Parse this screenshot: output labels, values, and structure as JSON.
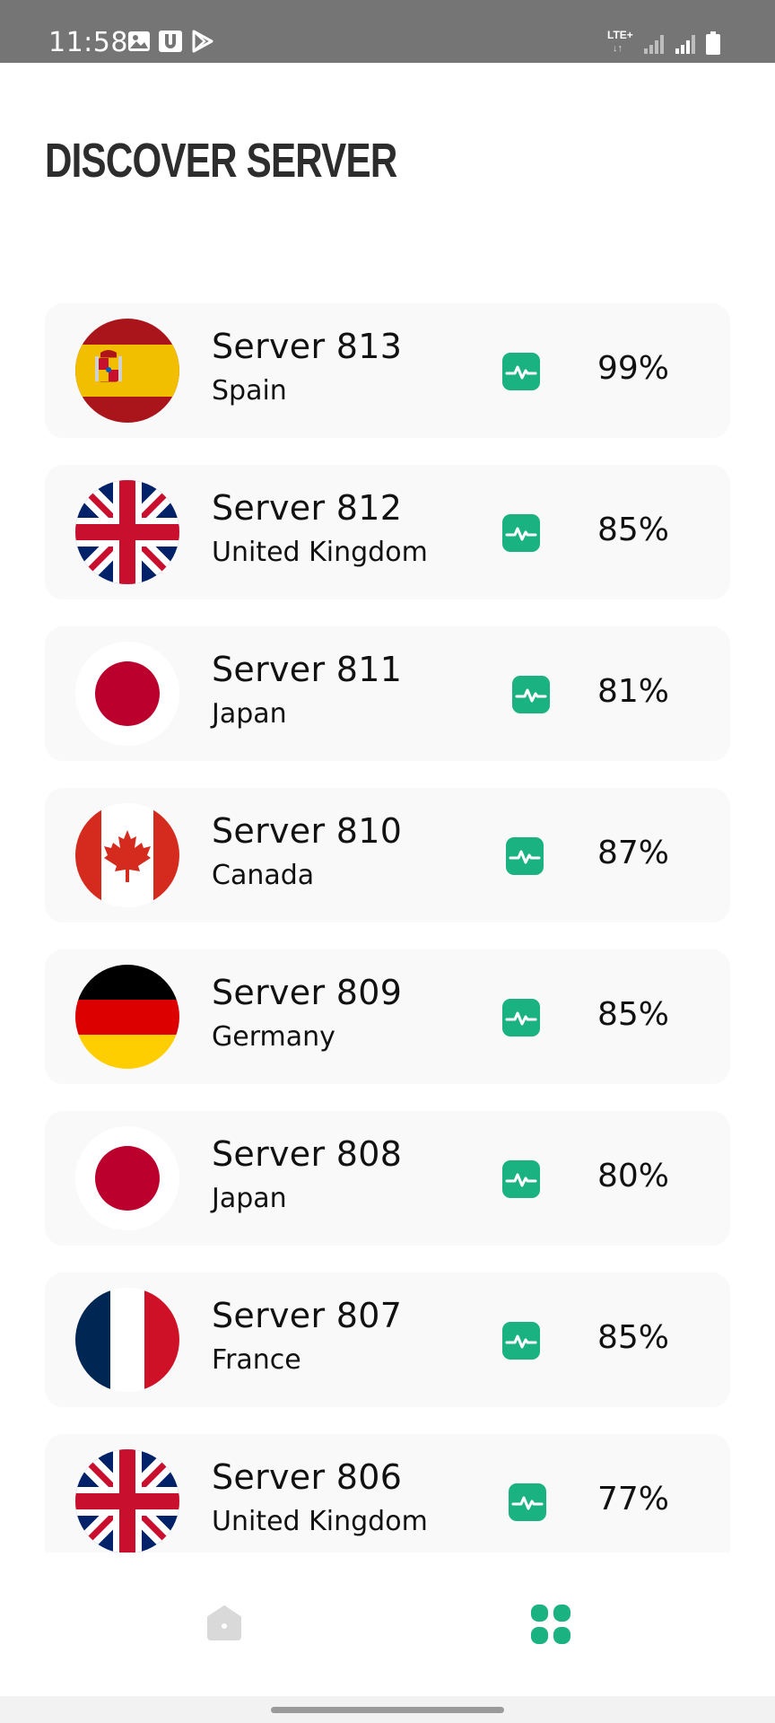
{
  "status_bar": {
    "time": "11:58",
    "network": "LTE+",
    "icons": [
      "image-icon",
      "u-app-icon",
      "play-store-icon",
      "lte-icon",
      "signal-icon",
      "signal-icon",
      "battery-icon"
    ]
  },
  "page": {
    "title": "DISCOVER SERVER"
  },
  "colors": {
    "accent": "#1bb281",
    "card_background": "#f9f9f9",
    "status_bar": "#757575",
    "inactive_nav": "#d9d9d9"
  },
  "servers": [
    {
      "name": "Server 813",
      "country": "Spain",
      "flag": "spain-flag-icon",
      "load": "99%"
    },
    {
      "name": "Server 812",
      "country": "United Kingdom",
      "flag": "uk-flag-icon",
      "load": "85%"
    },
    {
      "name": "Server 811",
      "country": "Japan",
      "flag": "japan-flag-icon",
      "load": "81%"
    },
    {
      "name": "Server 810",
      "country": "Canada",
      "flag": "canada-flag-icon",
      "load": "87%"
    },
    {
      "name": "Server 809",
      "country": "Germany",
      "flag": "germany-flag-icon",
      "load": "85%"
    },
    {
      "name": "Server 808",
      "country": "Japan",
      "flag": "japan-flag-icon",
      "load": "80%"
    },
    {
      "name": "Server 807",
      "country": "France",
      "flag": "france-flag-icon",
      "load": "85%"
    },
    {
      "name": "Server 806",
      "country": "United Kingdom",
      "flag": "uk-flag-icon",
      "load": "77%"
    }
  ],
  "bottom_nav": {
    "items": [
      {
        "icon": "home-icon",
        "active": false
      },
      {
        "icon": "grid-icon",
        "active": true
      }
    ]
  }
}
